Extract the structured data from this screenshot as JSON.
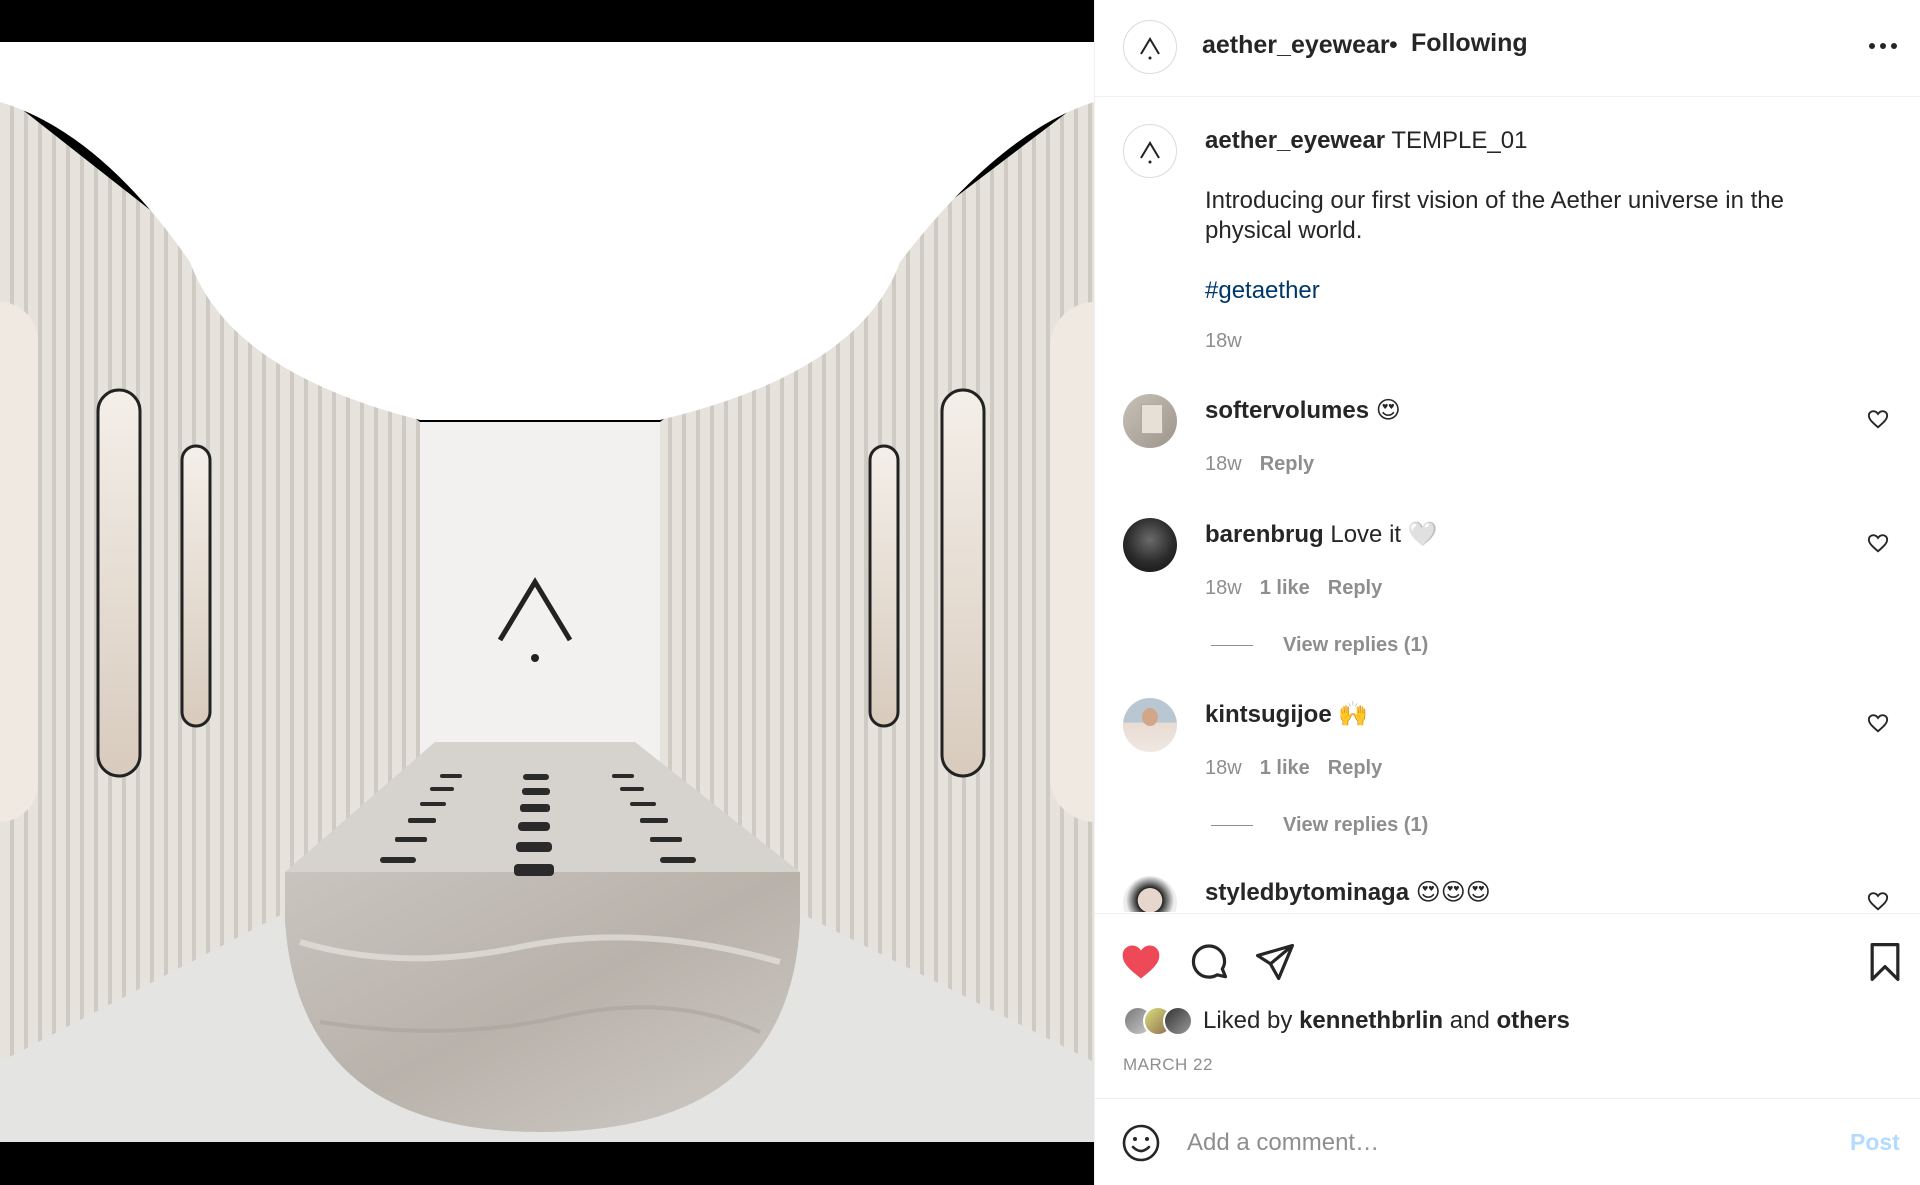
{
  "header": {
    "username": "aether_eyewear",
    "separator": "•",
    "follow_status": "Following"
  },
  "caption": {
    "username": "aether_eyewear",
    "title": "TEMPLE_01",
    "body": "Introducing our first vision of the Aether universe in the physical world.",
    "hashtag": "#getaether",
    "time": "18w"
  },
  "comments": [
    {
      "username": "softervolumes",
      "text": "😍",
      "time": "18w",
      "likes": "",
      "reply": "Reply",
      "view_replies": ""
    },
    {
      "username": "barenbrug",
      "text": "Love it 🤍",
      "time": "18w",
      "likes": "1 like",
      "reply": "Reply",
      "view_replies": "View replies (1)"
    },
    {
      "username": "kintsugijoe",
      "text": "🙌",
      "time": "18w",
      "likes": "1 like",
      "reply": "Reply",
      "view_replies": "View replies (1)"
    },
    {
      "username": "styledbytominaga",
      "text": "😍😍😍",
      "time": "",
      "likes": "",
      "reply": "",
      "view_replies": ""
    }
  ],
  "likes": {
    "prefix": "Liked by",
    "user": "kennethbrlin",
    "joiner": "and",
    "others": "others"
  },
  "post_date": "MARCH 22",
  "comment_box": {
    "placeholder": "Add a comment…",
    "post_label": "Post"
  },
  "icons": {
    "like": "heart-icon-filled",
    "comment": "comment-icon",
    "share": "paper-plane-icon",
    "save": "bookmark-icon",
    "emoji": "smiley-icon",
    "more": "more-dots-icon"
  },
  "colors": {
    "heart": "#ed4956",
    "hashtag": "#00376b",
    "post_disabled": "#b3dbff",
    "muted": "#8e8e8e"
  }
}
